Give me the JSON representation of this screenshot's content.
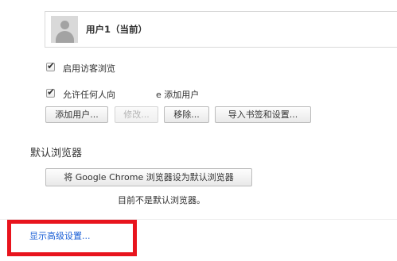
{
  "people": {
    "users": [
      {
        "name": "用户1（当前）",
        "avatar_icon": "default-user-avatar"
      }
    ],
    "enable_guest": {
      "label": "启用访客浏览",
      "checked": true
    },
    "allow_add": {
      "label": "允许任何人向",
      "label_suffix": "e 添加用户",
      "checked": true
    },
    "buttons": {
      "add_user": "添加用户...",
      "edit": "修改...",
      "remove": "移除...",
      "import": "导入书签和设置..."
    }
  },
  "default_browser": {
    "title": "默认浏览器",
    "button_label": "将 Google Chrome 浏览器设为默认浏览器",
    "status": "目前不是默认浏览器。"
  },
  "advanced": {
    "link_label": "显示高级设置..."
  },
  "colors": {
    "link": "#1a5fd6",
    "highlight": "#e8141d"
  }
}
